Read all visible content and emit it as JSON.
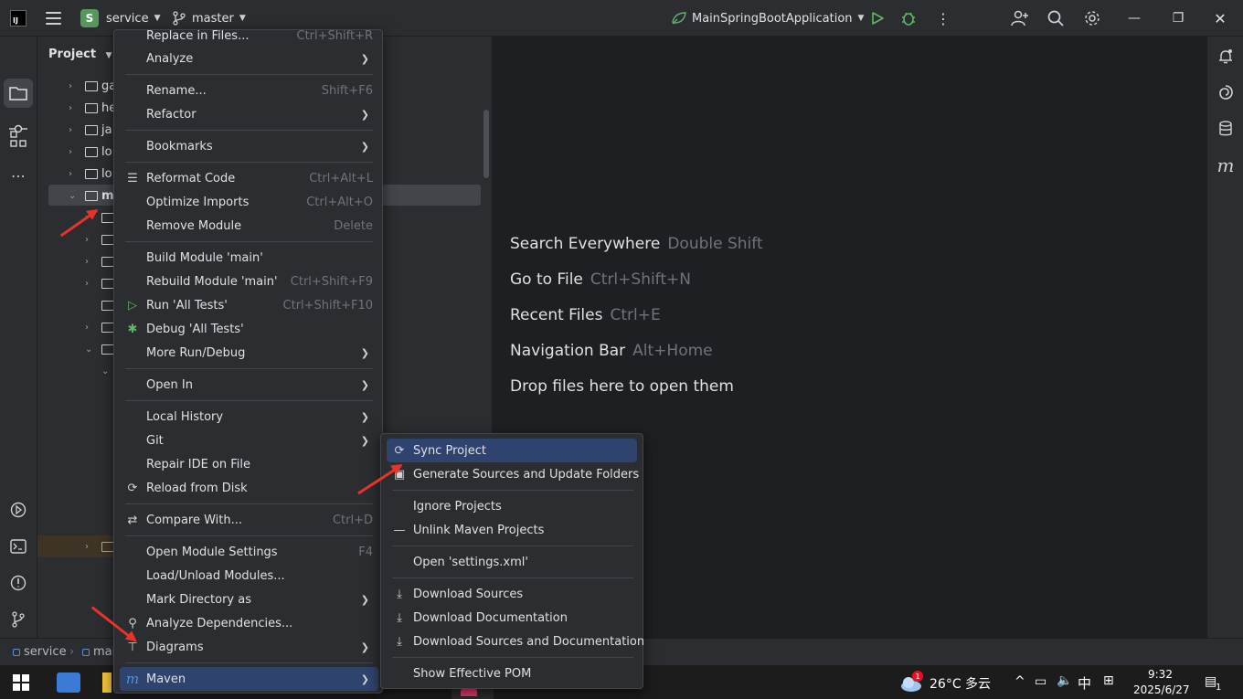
{
  "titlebar": {
    "project_initial": "S",
    "project_name": "service",
    "branch": "master",
    "run_config": "MainSpringBootApplication"
  },
  "project_panel": {
    "title": "Project",
    "rows": [
      {
        "label": "ga"
      },
      {
        "label": "he"
      },
      {
        "label": "ja"
      },
      {
        "label": "lo"
      },
      {
        "label": "lo"
      },
      {
        "label": "m"
      }
    ]
  },
  "editor": {
    "hints": [
      {
        "label": "Search Everywhere",
        "shortcut": "Double Shift"
      },
      {
        "label": "Go to File",
        "shortcut": "Ctrl+Shift+N"
      },
      {
        "label": "Recent Files",
        "shortcut": "Ctrl+E"
      },
      {
        "label": "Navigation Bar",
        "shortcut": "Alt+Home"
      },
      {
        "label": "Drop files here to open them",
        "shortcut": ""
      }
    ]
  },
  "context_menu": {
    "top_partial": {
      "label": "Replace in Files...",
      "shortcut": "Ctrl+Shift+R"
    },
    "items": [
      {
        "label": "Analyze",
        "shortcut": ""
      },
      {
        "label": "Rename...",
        "shortcut": "Shift+F6"
      },
      {
        "label": "Refactor",
        "shortcut": ""
      },
      {
        "label": "Bookmarks",
        "shortcut": ""
      },
      {
        "label": "Reformat Code",
        "shortcut": "Ctrl+Alt+L"
      },
      {
        "label": "Optimize Imports",
        "shortcut": "Ctrl+Alt+O"
      },
      {
        "label": "Remove Module",
        "shortcut": "Delete"
      },
      {
        "label": "Build Module 'main'",
        "shortcut": ""
      },
      {
        "label": "Rebuild Module 'main'",
        "shortcut": "Ctrl+Shift+F9"
      },
      {
        "label": "Run 'All Tests'",
        "shortcut": "Ctrl+Shift+F10"
      },
      {
        "label": "Debug 'All Tests'",
        "shortcut": ""
      },
      {
        "label": "More Run/Debug",
        "shortcut": ""
      },
      {
        "label": "Open In",
        "shortcut": ""
      },
      {
        "label": "Local History",
        "shortcut": ""
      },
      {
        "label": "Git",
        "shortcut": ""
      },
      {
        "label": "Repair IDE on File",
        "shortcut": ""
      },
      {
        "label": "Reload from Disk",
        "shortcut": ""
      },
      {
        "label": "Compare With...",
        "shortcut": "Ctrl+D"
      },
      {
        "label": "Open Module Settings",
        "shortcut": "F4"
      },
      {
        "label": "Load/Unload Modules...",
        "shortcut": ""
      },
      {
        "label": "Mark Directory as",
        "shortcut": ""
      },
      {
        "label": "Analyze Dependencies...",
        "shortcut": ""
      },
      {
        "label": "Diagrams",
        "shortcut": ""
      },
      {
        "label": "Maven",
        "shortcut": ""
      }
    ]
  },
  "maven_submenu": {
    "items": [
      {
        "label": "Sync Project"
      },
      {
        "label": "Generate Sources and Update Folders"
      },
      {
        "label": "Ignore Projects"
      },
      {
        "label": "Unlink Maven Projects"
      },
      {
        "label": "Open 'settings.xml'"
      },
      {
        "label": "Download Sources"
      },
      {
        "label": "Download Documentation"
      },
      {
        "label": "Download Sources and Documentation"
      },
      {
        "label": "Show Effective POM"
      }
    ]
  },
  "statusbar": {
    "crumb_1": "service",
    "crumb_2": "mai"
  },
  "taskbar": {
    "weather": "26°C 多云",
    "weather_badge": "1",
    "ime": "中",
    "time": "9:32",
    "date": "2025/6/27",
    "notif_count": "1"
  },
  "colors": {
    "highlight": "#2e436e",
    "arrow": "#e8322a",
    "run_green": "#57965c"
  }
}
